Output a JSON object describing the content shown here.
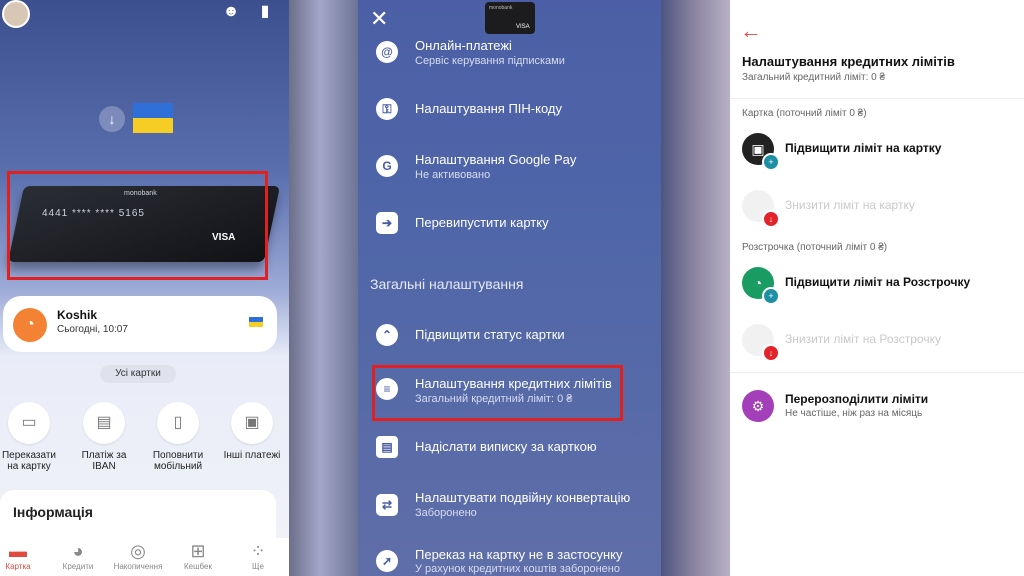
{
  "home": {
    "card": {
      "brand": "monobank",
      "number": "4441 **** **** 5165",
      "network": "VISA"
    },
    "jar": {
      "name": "Koshik",
      "time": "Сьогодні, 10:07"
    },
    "all_cards": "Усі картки",
    "actions": [
      {
        "label": "Переказати на картку",
        "icon": "card-icon"
      },
      {
        "label": "Платіж за IBAN",
        "icon": "document-icon"
      },
      {
        "label": "Поповнити мобільний",
        "icon": "phone-icon"
      },
      {
        "label": "Інші платежі",
        "icon": "wallet-icon"
      }
    ],
    "info_title": "Інформація",
    "nav": [
      "Картка",
      "Кредити",
      "Накопичення",
      "Кешбек",
      "Ще"
    ]
  },
  "card_menu": {
    "minicard_brand": "monobank",
    "minicard_network": "VISA",
    "items": [
      {
        "title": "Онлайн-платежі",
        "subtitle": "Сервіс керування підписками",
        "icon": "at-icon"
      },
      {
        "title": "Налаштування ПІН-коду",
        "subtitle": "",
        "icon": "key-icon"
      },
      {
        "title": "Налаштування Google Pay",
        "subtitle": "Не активовано",
        "icon": "google-icon"
      },
      {
        "title": "Перевипустити картку",
        "subtitle": "",
        "icon": "arrow-right-icon"
      }
    ],
    "section_title": "Загальні налаштування",
    "general_items": [
      {
        "title": "Підвищити статус картки",
        "subtitle": "",
        "icon": "chevrons-up-icon"
      },
      {
        "title": "Налаштування кредитних лімітів",
        "subtitle": "Загальний кредитний ліміт: 0 ₴",
        "icon": "database-icon"
      },
      {
        "title": "Надіслати виписку за карткою",
        "subtitle": "",
        "icon": "file-icon"
      },
      {
        "title": "Налаштувати подвійну конвертацію",
        "subtitle": "Заборонено",
        "icon": "swap-icon"
      },
      {
        "title": "Переказ на картку не в застосунку",
        "subtitle": "У рахунок кредитних коштів заборонено",
        "icon": "transfer-icon"
      }
    ]
  },
  "limits": {
    "title": "Налаштування кредитних лімітів",
    "subtitle": "Загальний кредитний ліміт: 0 ₴",
    "card_section": "Картка (поточний ліміт 0 ₴)",
    "raise_card": "Підвищити ліміт на картку",
    "lower_card": "Знизити ліміт на картку",
    "installment_section": "Розстрочка (поточний ліміт 0 ₴)",
    "raise_installment": "Підвищити ліміт на Розстрочку",
    "lower_installment": "Знизити ліміт на Розстрочку",
    "redistribute": "Перерозподілити ліміти",
    "redistribute_sub": "Не частіше, ніж раз на місяць"
  },
  "colors": {
    "highlight": "#e0211f",
    "accent_red": "#e2493f",
    "panel_blue": "#4f66a8"
  }
}
